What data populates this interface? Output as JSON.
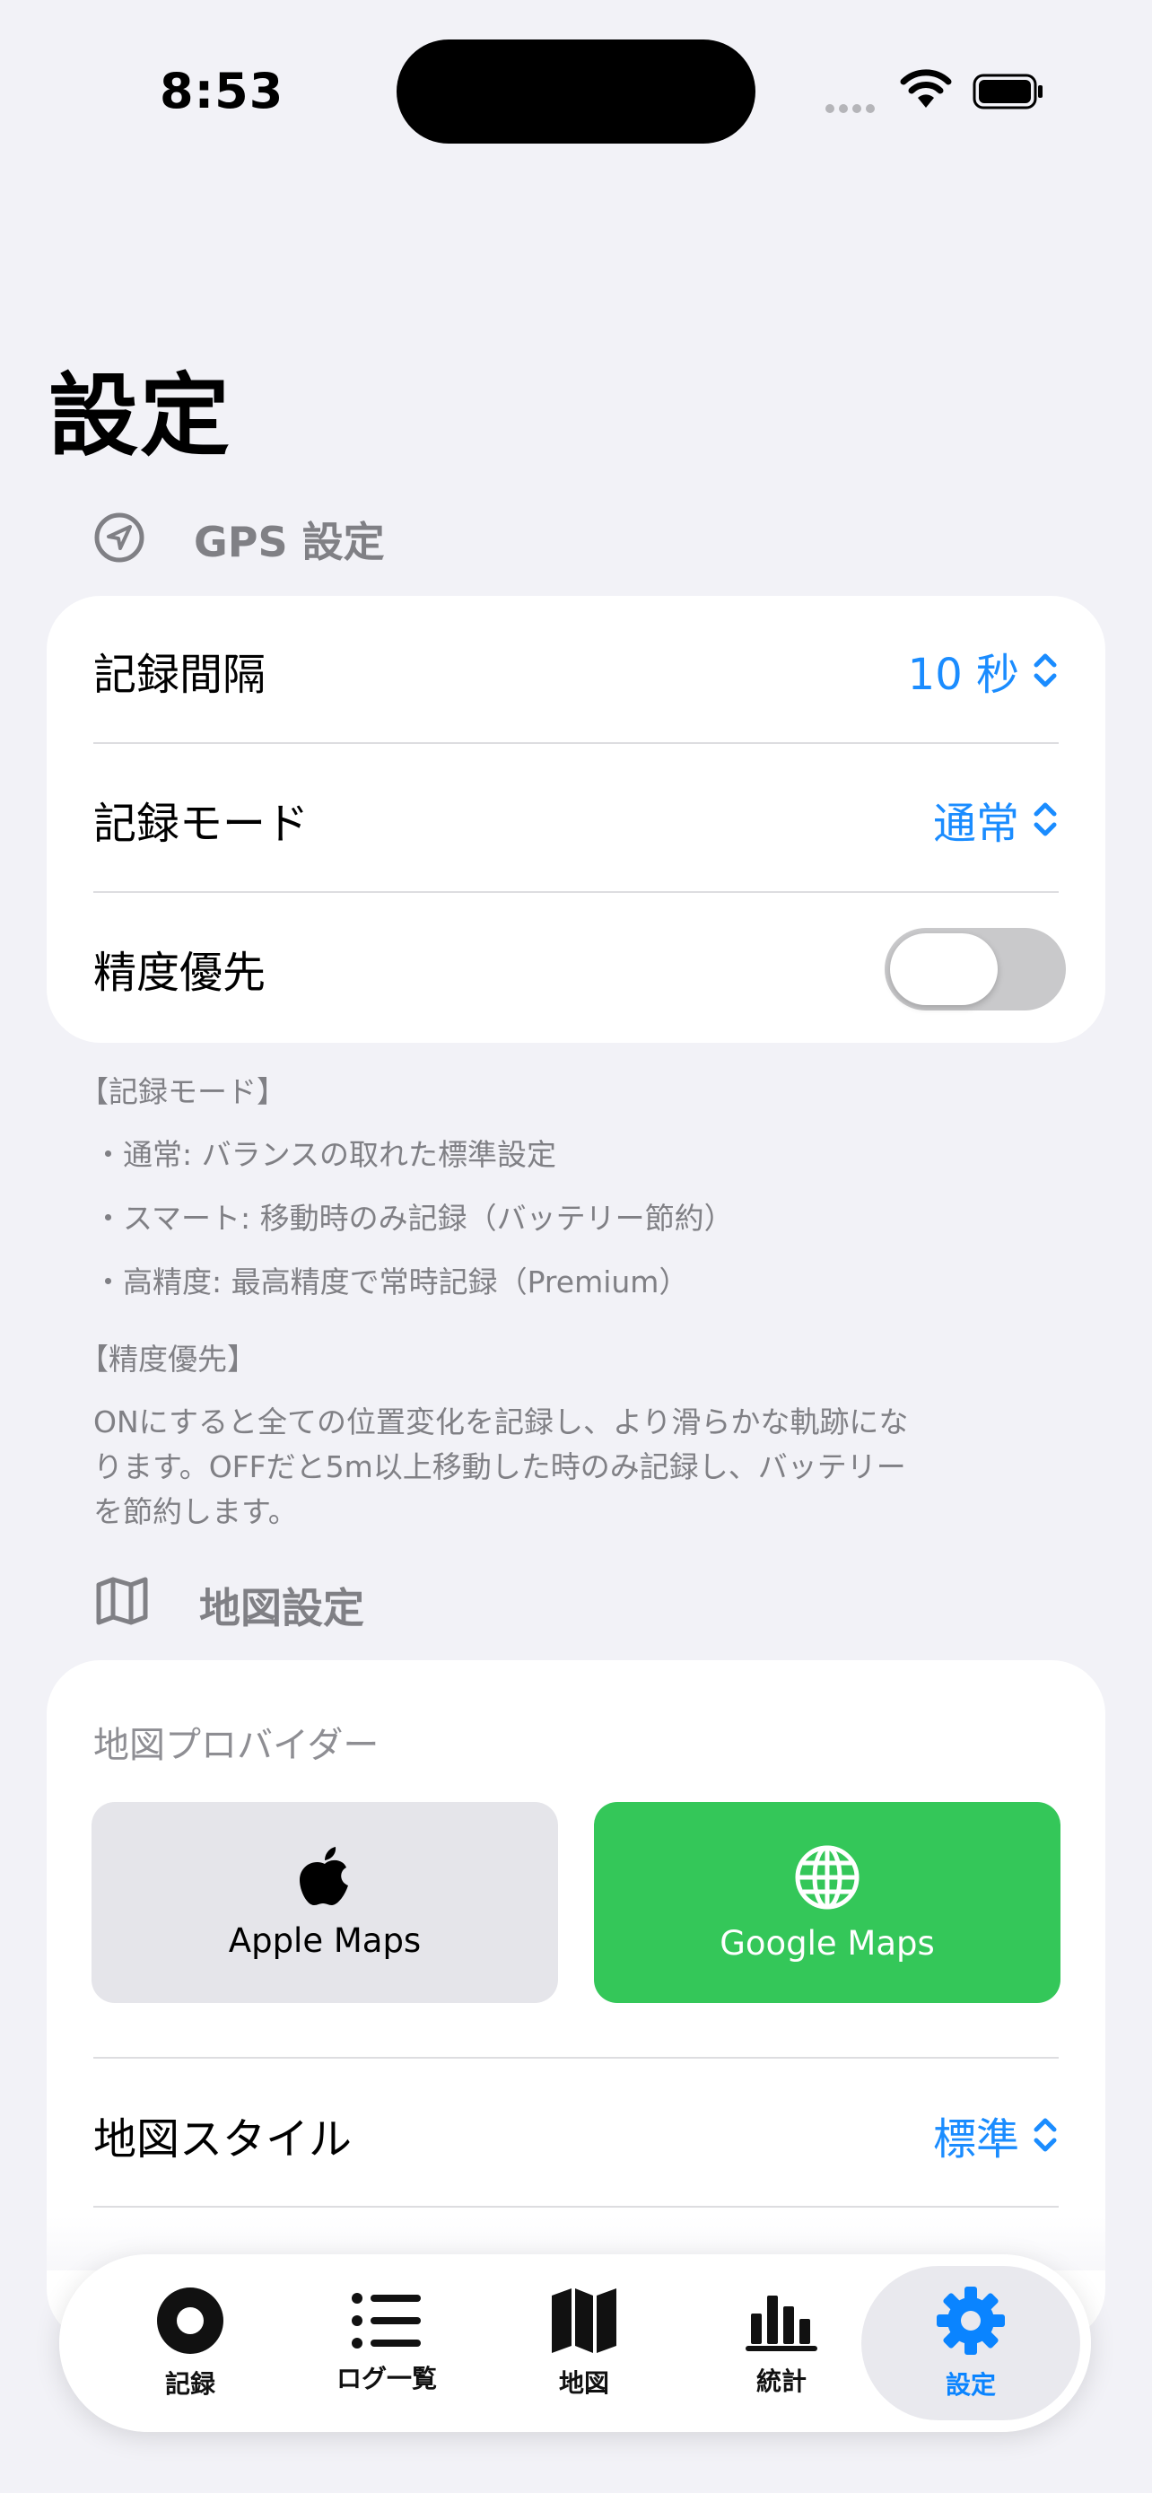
{
  "status_bar": {
    "time": "8:53"
  },
  "page": {
    "title": "設定"
  },
  "gps_section": {
    "title": "GPS 設定",
    "rows": {
      "interval": {
        "label": "記録間隔",
        "value": "10 秒"
      },
      "mode": {
        "label": "記録モード",
        "value": "通常"
      },
      "precision": {
        "label": "精度優先",
        "toggle_on": false
      }
    },
    "notes": {
      "mode_head": "【記録モード】",
      "mode_lines": [
        "・通常: バランスの取れた標準設定",
        "・スマート: 移動時のみ記録（バッテリー節約）",
        "・高精度: 最高精度で常時記録（Premium）"
      ],
      "precision_head": "【精度優先】",
      "precision_lines": [
        "ONにすると全ての位置変化を記録し、より滑らかな軌跡にな",
        "ります。OFFだと5m以上移動した時のみ記録し、バッテリー",
        "を節約します。"
      ]
    }
  },
  "map_section": {
    "title": "地図設定",
    "provider_label": "地図プロバイダー",
    "providers": [
      {
        "name": "Apple Maps",
        "icon": "apple-icon",
        "selected": false
      },
      {
        "name": "Google Maps",
        "icon": "globe-icon",
        "selected": true
      }
    ],
    "style": {
      "label": "地図スタイル",
      "value": "標準"
    }
  },
  "tab_bar": {
    "items": [
      {
        "label": "記録",
        "icon": "record-icon",
        "active": false
      },
      {
        "label": "ログ一覧",
        "icon": "list-icon",
        "active": false
      },
      {
        "label": "地図",
        "icon": "map-icon",
        "active": false
      },
      {
        "label": "統計",
        "icon": "chart-icon",
        "active": false
      },
      {
        "label": "設定",
        "icon": "gear-icon",
        "active": true
      }
    ]
  },
  "colors": {
    "accent": "#1a8cff",
    "selected_provider": "#34c759",
    "background": "#f2f2f7"
  }
}
